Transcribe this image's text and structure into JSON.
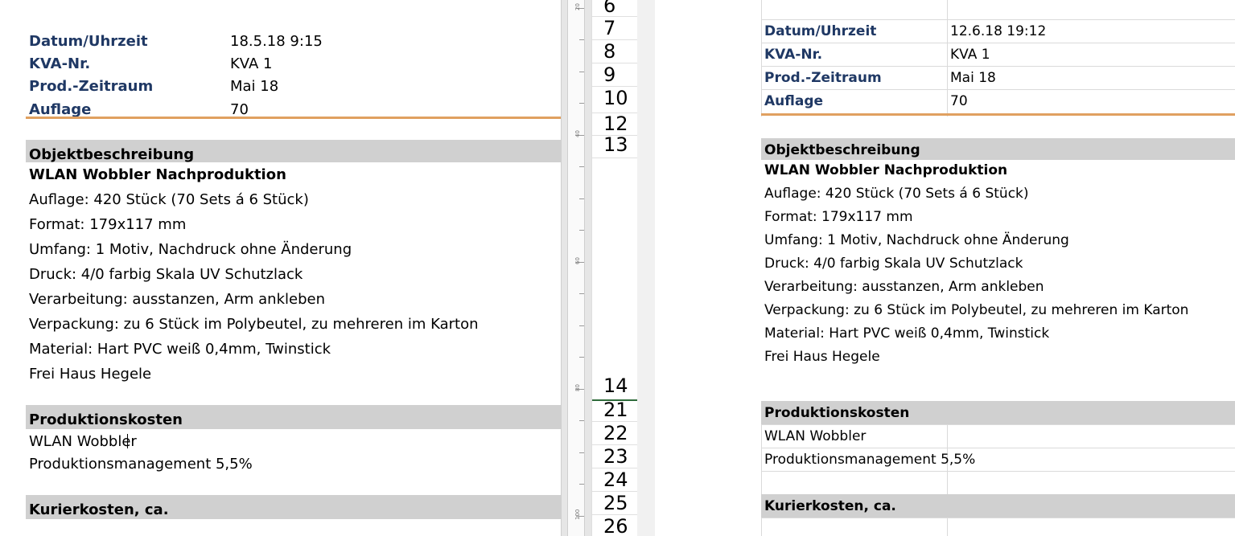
{
  "left": {
    "header": [
      {
        "label": "Datum/Uhrzeit",
        "value": "18.5.18 9:15"
      },
      {
        "label": "KVA-Nr.",
        "value": "KVA 1"
      },
      {
        "label": "Prod.-Zeitraum",
        "value": "Mai 18"
      },
      {
        "label": "Auflage",
        "value": "70"
      }
    ],
    "object_section": "Objektbeschreibung",
    "object_lines": [
      "WLAN Wobbler Nachproduktion",
      "Auflage: 420 Stück (70 Sets á 6 Stück)",
      "Format: 179x117 mm",
      "Umfang: 1 Motiv, Nachdruck ohne Änderung",
      "Druck: 4/0 farbig Skala UV Schutzlack",
      "Verarbeitung: ausstanzen, Arm ankleben",
      "Verpackung: zu 6 Stück im Polybeutel, zu mehreren im Karton",
      "Material: Hart PVC weiß 0,4mm, Twinstick",
      "Frei Haus Hegele"
    ],
    "production_section": "Produktionskosten",
    "production_lines": {
      "item1_a": "WLAN Wobble",
      "item1_b": "r",
      "item2": "Produktionsmanagement 5,5%"
    },
    "courier_section": "Kurierkosten, ca."
  },
  "ruler": {
    "labels": [
      "20",
      "40",
      "60",
      "80",
      "100"
    ]
  },
  "row_numbers": {
    "top": [
      "6",
      "7",
      "8",
      "9",
      "10",
      "12",
      "13"
    ],
    "bottom": [
      "14",
      "21",
      "22",
      "23",
      "24",
      "25",
      "26"
    ]
  },
  "right": {
    "header": [
      {
        "label": "Datum/Uhrzeit",
        "value": "12.6.18 19:12"
      },
      {
        "label": "KVA-Nr.",
        "value": "KVA 1"
      },
      {
        "label": "Prod.-Zeitraum",
        "value": "Mai 18"
      },
      {
        "label": "Auflage",
        "value": "70"
      }
    ],
    "object_section": "Objektbeschreibung",
    "object_lines": [
      "WLAN Wobbler Nachproduktion",
      "Auflage: 420 Stück (70 Sets á 6 Stück)",
      "Format: 179x117 mm",
      "Umfang: 1 Motiv, Nachdruck ohne Änderung",
      "Druck: 4/0 farbig Skala UV Schutzlack",
      "Verarbeitung: ausstanzen, Arm ankleben",
      "Verpackung: zu 6 Stück im Polybeutel, zu mehreren im Karton",
      "Material: Hart PVC weiß 0,4mm, Twinstick",
      "Frei Haus Hegele"
    ],
    "production_section": "Produktionskosten",
    "production_lines": [
      "WLAN Wobbler",
      "Produktionsmanagement 5,5%"
    ],
    "courier_section": "Kurierkosten, ca."
  },
  "colors": {
    "label": "#1f3864",
    "section_bg": "#d0d0d0",
    "accent_line": "#e0a060",
    "selection": "#2e6b3a"
  }
}
